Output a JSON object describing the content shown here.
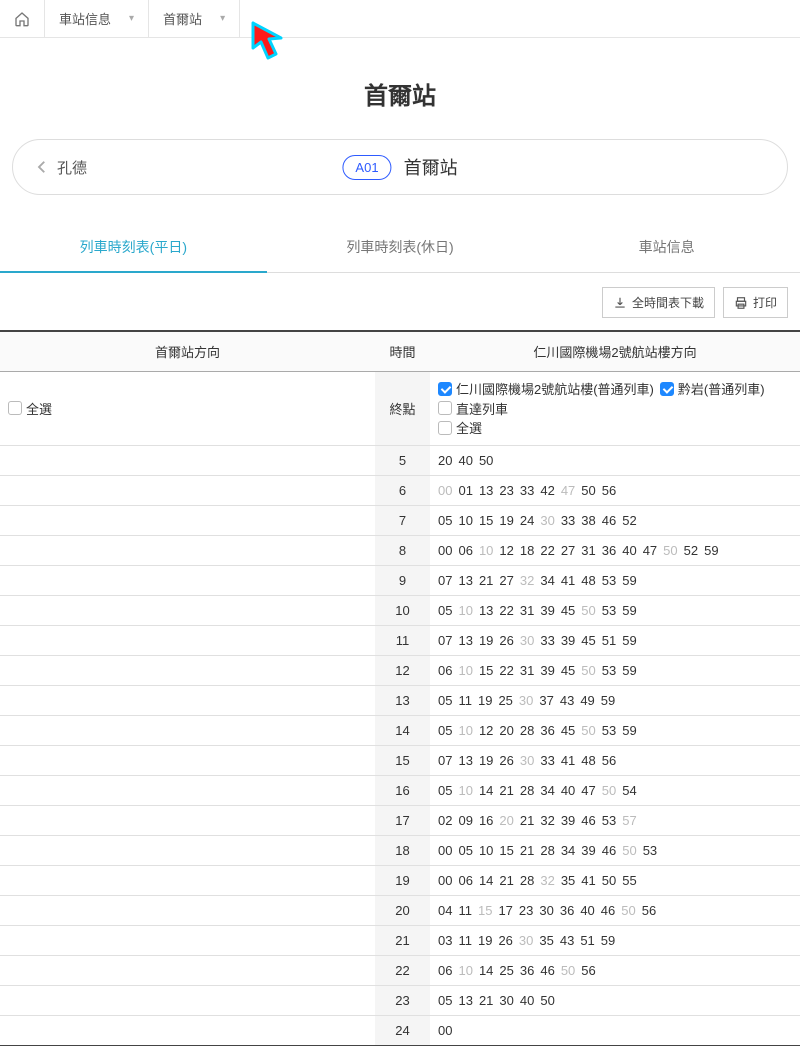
{
  "nav": {
    "breadcrumb1": "車站信息",
    "breadcrumb2": "首爾站"
  },
  "title": "首爾站",
  "station_bar": {
    "prev": "孔德",
    "code": "A01",
    "name": "首爾站"
  },
  "tabs": [
    {
      "label": "列車時刻表(平日)",
      "active": true
    },
    {
      "label": "列車時刻表(休日)",
      "active": false
    },
    {
      "label": "車站信息",
      "active": false
    }
  ],
  "buttons": {
    "download": "全時間表下載",
    "print": "打印"
  },
  "headers": {
    "left": "首爾站方向",
    "mid": "時間",
    "right": "仁川國際機場2號航站樓方向"
  },
  "filters": {
    "left_all": "全選",
    "mid_label": "終點",
    "right": [
      {
        "label": "仁川國際機場2號航站樓(普通列車)",
        "checked": true
      },
      {
        "label": "黔岩(普通列車)",
        "checked": true
      },
      {
        "label": "直達列車",
        "checked": false
      },
      {
        "label": "全選",
        "checked": false
      }
    ]
  },
  "rows": [
    {
      "hour": "5",
      "mins": [
        [
          "20",
          0
        ],
        [
          "40",
          0
        ],
        [
          "50",
          0
        ]
      ]
    },
    {
      "hour": "6",
      "mins": [
        [
          "00",
          1
        ],
        [
          "01",
          0
        ],
        [
          "13",
          0
        ],
        [
          "23",
          0
        ],
        [
          "33",
          0
        ],
        [
          "42",
          0
        ],
        [
          "47",
          1
        ],
        [
          "50",
          0
        ],
        [
          "56",
          0
        ]
      ]
    },
    {
      "hour": "7",
      "mins": [
        [
          "05",
          0
        ],
        [
          "10",
          0
        ],
        [
          "15",
          0
        ],
        [
          "19",
          0
        ],
        [
          "24",
          0
        ],
        [
          "30",
          1
        ],
        [
          "33",
          0
        ],
        [
          "38",
          0
        ],
        [
          "46",
          0
        ],
        [
          "52",
          0
        ]
      ]
    },
    {
      "hour": "8",
      "mins": [
        [
          "00",
          0
        ],
        [
          "06",
          0
        ],
        [
          "10",
          1
        ],
        [
          "12",
          0
        ],
        [
          "18",
          0
        ],
        [
          "22",
          0
        ],
        [
          "27",
          0
        ],
        [
          "31",
          0
        ],
        [
          "36",
          0
        ],
        [
          "40",
          0
        ],
        [
          "47",
          0
        ],
        [
          "50",
          1
        ],
        [
          "52",
          0
        ],
        [
          "59",
          0
        ]
      ]
    },
    {
      "hour": "9",
      "mins": [
        [
          "07",
          0
        ],
        [
          "13",
          0
        ],
        [
          "21",
          0
        ],
        [
          "27",
          0
        ],
        [
          "32",
          1
        ],
        [
          "34",
          0
        ],
        [
          "41",
          0
        ],
        [
          "48",
          0
        ],
        [
          "53",
          0
        ],
        [
          "59",
          0
        ]
      ]
    },
    {
      "hour": "10",
      "mins": [
        [
          "05",
          0
        ],
        [
          "10",
          1
        ],
        [
          "13",
          0
        ],
        [
          "22",
          0
        ],
        [
          "31",
          0
        ],
        [
          "39",
          0
        ],
        [
          "45",
          0
        ],
        [
          "50",
          1
        ],
        [
          "53",
          0
        ],
        [
          "59",
          0
        ]
      ]
    },
    {
      "hour": "11",
      "mins": [
        [
          "07",
          0
        ],
        [
          "13",
          0
        ],
        [
          "19",
          0
        ],
        [
          "26",
          0
        ],
        [
          "30",
          1
        ],
        [
          "33",
          0
        ],
        [
          "39",
          0
        ],
        [
          "45",
          0
        ],
        [
          "51",
          0
        ],
        [
          "59",
          0
        ]
      ]
    },
    {
      "hour": "12",
      "mins": [
        [
          "06",
          0
        ],
        [
          "10",
          1
        ],
        [
          "15",
          0
        ],
        [
          "22",
          0
        ],
        [
          "31",
          0
        ],
        [
          "39",
          0
        ],
        [
          "45",
          0
        ],
        [
          "50",
          1
        ],
        [
          "53",
          0
        ],
        [
          "59",
          0
        ]
      ]
    },
    {
      "hour": "13",
      "mins": [
        [
          "05",
          0
        ],
        [
          "11",
          0
        ],
        [
          "19",
          0
        ],
        [
          "25",
          0
        ],
        [
          "30",
          1
        ],
        [
          "37",
          0
        ],
        [
          "43",
          0
        ],
        [
          "49",
          0
        ],
        [
          "59",
          0
        ]
      ]
    },
    {
      "hour": "14",
      "mins": [
        [
          "05",
          0
        ],
        [
          "10",
          1
        ],
        [
          "12",
          0
        ],
        [
          "20",
          0
        ],
        [
          "28",
          0
        ],
        [
          "36",
          0
        ],
        [
          "45",
          0
        ],
        [
          "50",
          1
        ],
        [
          "53",
          0
        ],
        [
          "59",
          0
        ]
      ]
    },
    {
      "hour": "15",
      "mins": [
        [
          "07",
          0
        ],
        [
          "13",
          0
        ],
        [
          "19",
          0
        ],
        [
          "26",
          0
        ],
        [
          "30",
          1
        ],
        [
          "33",
          0
        ],
        [
          "41",
          0
        ],
        [
          "48",
          0
        ],
        [
          "56",
          0
        ]
      ]
    },
    {
      "hour": "16",
      "mins": [
        [
          "05",
          0
        ],
        [
          "10",
          1
        ],
        [
          "14",
          0
        ],
        [
          "21",
          0
        ],
        [
          "28",
          0
        ],
        [
          "34",
          0
        ],
        [
          "40",
          0
        ],
        [
          "47",
          0
        ],
        [
          "50",
          1
        ],
        [
          "54",
          0
        ]
      ]
    },
    {
      "hour": "17",
      "mins": [
        [
          "02",
          0
        ],
        [
          "09",
          0
        ],
        [
          "16",
          0
        ],
        [
          "20",
          1
        ],
        [
          "21",
          0
        ],
        [
          "32",
          0
        ],
        [
          "39",
          0
        ],
        [
          "46",
          0
        ],
        [
          "53",
          0
        ],
        [
          "57",
          1
        ]
      ]
    },
    {
      "hour": "18",
      "mins": [
        [
          "00",
          0
        ],
        [
          "05",
          0
        ],
        [
          "10",
          0
        ],
        [
          "15",
          0
        ],
        [
          "21",
          0
        ],
        [
          "28",
          0
        ],
        [
          "34",
          0
        ],
        [
          "39",
          0
        ],
        [
          "46",
          0
        ],
        [
          "50",
          1
        ],
        [
          "53",
          0
        ]
      ]
    },
    {
      "hour": "19",
      "mins": [
        [
          "00",
          0
        ],
        [
          "06",
          0
        ],
        [
          "14",
          0
        ],
        [
          "21",
          0
        ],
        [
          "28",
          0
        ],
        [
          "32",
          1
        ],
        [
          "35",
          0
        ],
        [
          "41",
          0
        ],
        [
          "50",
          0
        ],
        [
          "55",
          0
        ]
      ]
    },
    {
      "hour": "20",
      "mins": [
        [
          "04",
          0
        ],
        [
          "11",
          0
        ],
        [
          "15",
          1
        ],
        [
          "17",
          0
        ],
        [
          "23",
          0
        ],
        [
          "30",
          0
        ],
        [
          "36",
          0
        ],
        [
          "40",
          0
        ],
        [
          "46",
          0
        ],
        [
          "50",
          1
        ],
        [
          "56",
          0
        ]
      ]
    },
    {
      "hour": "21",
      "mins": [
        [
          "03",
          0
        ],
        [
          "11",
          0
        ],
        [
          "19",
          0
        ],
        [
          "26",
          0
        ],
        [
          "30",
          1
        ],
        [
          "35",
          0
        ],
        [
          "43",
          0
        ],
        [
          "51",
          0
        ],
        [
          "59",
          0
        ]
      ]
    },
    {
      "hour": "22",
      "mins": [
        [
          "06",
          0
        ],
        [
          "10",
          1
        ],
        [
          "14",
          0
        ],
        [
          "25",
          0
        ],
        [
          "36",
          0
        ],
        [
          "46",
          0
        ],
        [
          "50",
          1
        ],
        [
          "56",
          0
        ]
      ]
    },
    {
      "hour": "23",
      "mins": [
        [
          "05",
          0
        ],
        [
          "13",
          0
        ],
        [
          "21",
          0
        ],
        [
          "30",
          0
        ],
        [
          "40",
          0
        ],
        [
          "50",
          0
        ]
      ]
    },
    {
      "hour": "24",
      "mins": [
        [
          "00",
          0
        ]
      ]
    }
  ]
}
